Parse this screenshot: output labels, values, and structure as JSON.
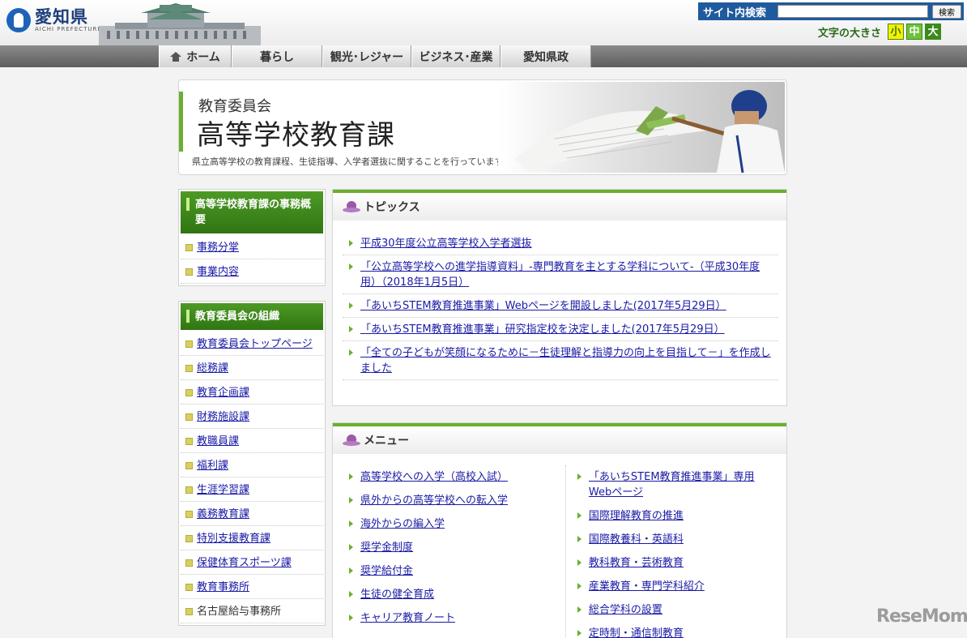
{
  "header": {
    "logo_title": "愛知県",
    "logo_sub": "AICHI PREFECTURE",
    "search_label": "サイト内検索",
    "search_value": "",
    "search_button": "検索",
    "fontsize_label": "文字の大きさ",
    "fontsize_small": "小",
    "fontsize_mid": "中",
    "fontsize_large": "大"
  },
  "nav": {
    "home": "ホーム",
    "living": "暮らし",
    "tourism": "観光･レジャー",
    "business": "ビジネス･産業",
    "government": "愛知県政"
  },
  "banner": {
    "org": "教育委員会",
    "title": "高等学校教育課",
    "description": "県立高等学校の教育課程、生徒指導、入学者選抜に関することを行っています。"
  },
  "sidebar": {
    "box1_head": "高等学校教育課の事務概要",
    "box1_items": [
      "事務分掌",
      "事業内容"
    ],
    "box2_head": "教育委員会の組織",
    "box2_items": [
      "教育委員会トップページ",
      "総務課",
      "教育企画課",
      "財務施設課",
      "教職員課",
      "福利課",
      "生涯学習課",
      "義務教育課",
      "特別支援教育課",
      "保健体育スポーツ課",
      "教育事務所",
      "名古屋給与事務所"
    ]
  },
  "topics": {
    "heading": "トピックス",
    "items": [
      "平成30年度公立高等学校入学者選抜",
      "「公立高等学校への進学指導資料」-専門教育を主とする学科について-（平成30年度用）（2018年1月5日）",
      "「あいちSTEM教育推進事業」Webページを開設しました(2017年5月29日）",
      "「あいちSTEM教育推進事業」研究指定校を決定しました(2017年5月29日）",
      "「全ての子どもが笑顔になるために－生徒理解と指導力の向上を目指して－」を作成しました"
    ]
  },
  "menu": {
    "heading": "メニュー",
    "left": [
      "高等学校への入学（高校入試）",
      "県外からの高等学校への転入学",
      "海外からの編入学",
      "奨学金制度",
      "奨学給付金",
      "生徒の健全育成",
      "キャリア教育ノート"
    ],
    "right": [
      "「あいちSTEM教育推進事業」専用Webページ",
      "国際理解教育の推進",
      "国際教養科・英語科",
      "教科教育・芸術教育",
      "産業教育・専門学科紹介",
      "総合学科の設置",
      "定時制・通信制教育"
    ]
  },
  "watermark": "ReseMom"
}
